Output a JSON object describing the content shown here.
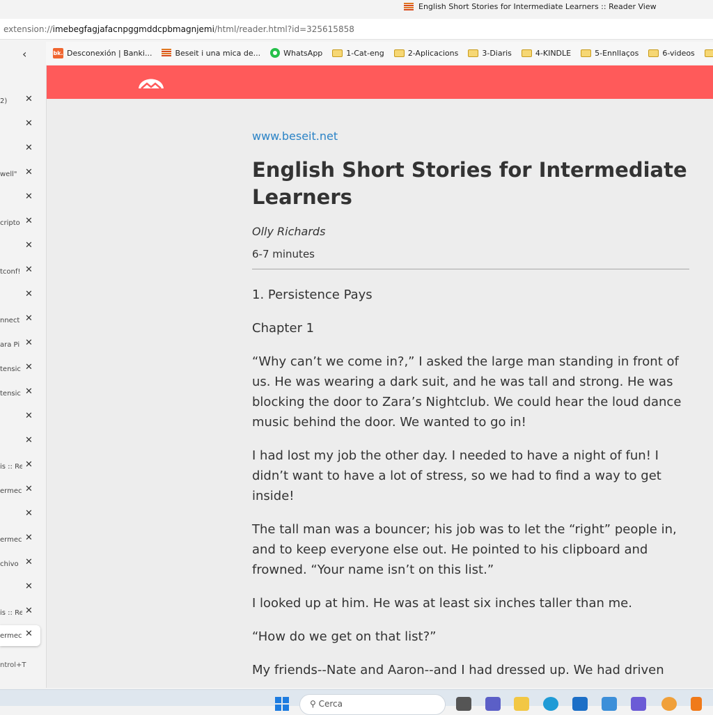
{
  "window": {
    "title": "English Short Stories for Intermediate Learners :: Reader View"
  },
  "address": {
    "prefix": "extension://",
    "host": "imebegfagjafacnpggmddcpbmagnjemi",
    "path": "/html/reader.html?id=325615858"
  },
  "bookmarks": [
    {
      "icon": "bk-icon",
      "label": "Desconexión | Banki..."
    },
    {
      "icon": "beseit-icon",
      "label": "Beseit i una mica de..."
    },
    {
      "icon": "whatsapp-icon",
      "label": "WhatsApp"
    },
    {
      "icon": "folder-icon",
      "label": "1-Cat-eng"
    },
    {
      "icon": "folder-icon",
      "label": "2-Aplicacions"
    },
    {
      "icon": "folder-icon",
      "label": "3-Diaris"
    },
    {
      "icon": "folder-icon",
      "label": "4-KINDLE"
    },
    {
      "icon": "folder-icon",
      "label": "5-Ennllaços"
    },
    {
      "icon": "folder-icon",
      "label": "6-videos"
    }
  ],
  "sidebar": {
    "tabs": [
      {
        "label": "2)"
      },
      {
        "label": ""
      },
      {
        "label": ""
      },
      {
        "label": "well\""
      },
      {
        "label": ""
      },
      {
        "label": "cripto"
      },
      {
        "label": ""
      },
      {
        "label": "tconf!"
      },
      {
        "label": ""
      },
      {
        "label": "nnect"
      },
      {
        "label": "ara Pi"
      },
      {
        "label": "tensic"
      },
      {
        "label": "tensic"
      },
      {
        "label": ""
      },
      {
        "label": ""
      },
      {
        "label": "is :: Re"
      },
      {
        "label": "ermec"
      },
      {
        "label": ""
      },
      {
        "label": "ermec"
      },
      {
        "label": "chivo"
      },
      {
        "label": ""
      },
      {
        "label": "is :: Re"
      },
      {
        "label": "ermec"
      }
    ],
    "new_tab_shortcut": "ntrol+T"
  },
  "article": {
    "site": "www.beseit.net",
    "title": "English Short Stories for Intermediate Learners",
    "author": "Olly Richards",
    "read_time": "6-7 minutes",
    "paragraphs": [
      "1. Persistence Pays",
      "Chapter 1",
      "“Why can’t we come in?,” I asked the large man standing in front of us. He was wearing a dark suit, and he was tall and strong. He was blocking the door to Zara’s Nightclub. We could hear the loud dance music behind the door. We wanted to go in!",
      "I had lost my job the other day. I needed to have a night of fun! I didn’t want to have a lot of stress, so we had to find a way to get inside!",
      "The tall man was a bouncer; his job was to let the “right” people in, and to keep everyone else out. He pointed to his clipboard and frowned. “Your name isn’t on this list.”",
      "I looked up at him. He was at least six inches taller than me.",
      "“How do we get on that list?”",
      "My friends--Nate and Aaron--and I had dressed up. We had driven"
    ]
  },
  "taskbar": {
    "search_placeholder": "Cerca"
  },
  "colors": {
    "reader_bar": "#ff5a5a",
    "link": "#2b83c6"
  }
}
